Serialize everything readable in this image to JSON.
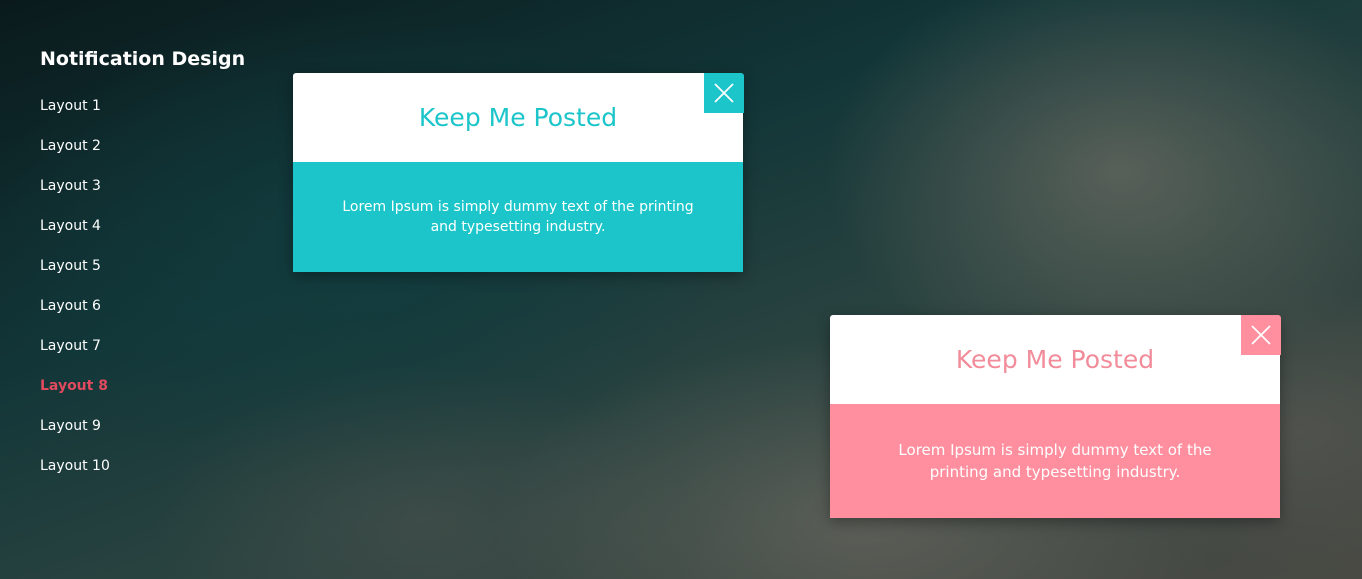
{
  "sidebar": {
    "title": "Notification Design",
    "items": [
      {
        "label": "Layout 1"
      },
      {
        "label": "Layout 2"
      },
      {
        "label": "Layout 3"
      },
      {
        "label": "Layout 4"
      },
      {
        "label": "Layout 5"
      },
      {
        "label": "Layout 6"
      },
      {
        "label": "Layout 7"
      },
      {
        "label": "Layout 8"
      },
      {
        "label": "Layout 9"
      },
      {
        "label": "Layout 10"
      }
    ],
    "active_item": "Layout 8",
    "active_color": "#e04a5f"
  },
  "notifications": [
    {
      "title": "Keep Me Posted",
      "message": "Lorem Ipsum is simply dummy text of the printing and typesetting industry.",
      "accent_color": "#1bc5ca",
      "close_icon": "close-icon"
    },
    {
      "title": "Keep Me Posted",
      "message": "Lorem Ipsum is simply dummy text of the printing and typesetting industry.",
      "accent_color": "#ff8e9e",
      "close_icon": "close-icon"
    }
  ]
}
